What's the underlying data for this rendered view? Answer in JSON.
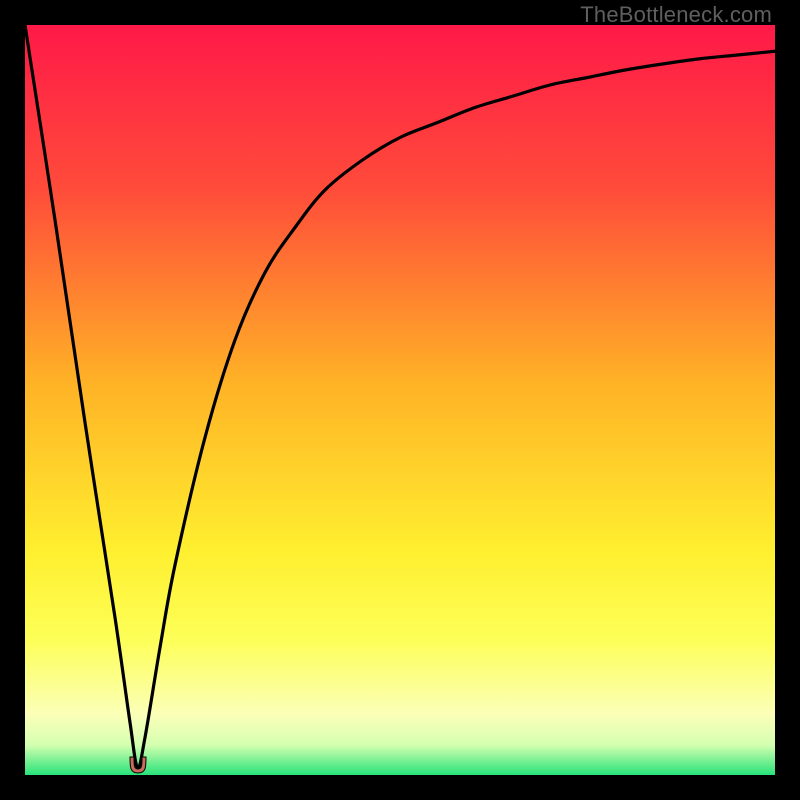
{
  "watermark": "TheBottleneck.com",
  "chart_data": {
    "type": "line",
    "title": "",
    "xlabel": "",
    "ylabel": "",
    "xlim": [
      0,
      100
    ],
    "ylim": [
      0,
      100
    ],
    "grid": false,
    "legend": false,
    "series": [
      {
        "name": "bottleneck-curve",
        "x": [
          0,
          4,
          8,
          12,
          14,
          15,
          16,
          18,
          20,
          24,
          28,
          32,
          36,
          40,
          45,
          50,
          55,
          60,
          65,
          70,
          75,
          80,
          85,
          90,
          95,
          100
        ],
        "values": [
          100,
          74,
          47,
          21,
          7,
          1,
          5,
          17,
          28,
          45,
          58,
          67,
          73,
          78,
          82,
          85,
          87,
          89,
          90.5,
          92,
          93,
          94,
          94.8,
          95.5,
          96,
          96.5
        ]
      }
    ],
    "min_marker": {
      "x": 15,
      "y": 0,
      "color": "#c96a5a"
    },
    "background_gradient_stops": [
      {
        "pct": 0,
        "color": "#ff1948"
      },
      {
        "pct": 22,
        "color": "#ff4c3a"
      },
      {
        "pct": 48,
        "color": "#ffb326"
      },
      {
        "pct": 70,
        "color": "#ffef2f"
      },
      {
        "pct": 82,
        "color": "#fdff58"
      },
      {
        "pct": 92,
        "color": "#fbffb8"
      },
      {
        "pct": 96,
        "color": "#d4ffb0"
      },
      {
        "pct": 100,
        "color": "#27e37a"
      }
    ]
  }
}
